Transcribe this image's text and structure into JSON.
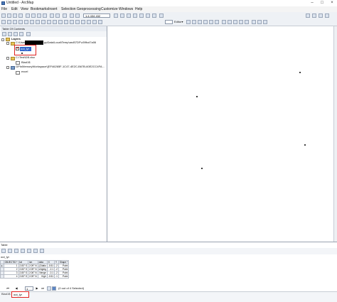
{
  "window": {
    "title": "Untitled - ArcMap",
    "controls": [
      "–",
      "□",
      "×"
    ]
  },
  "menu": [
    "File",
    "Edit",
    "View",
    "Bookmarks",
    "Insert",
    "Selection",
    "Geoprocessing",
    "Customize",
    "Windows",
    "Help"
  ],
  "toolbar": {
    "scale": "1:4 434 432",
    "editor_label": "Editor▾"
  },
  "toc": {
    "title": "Table Of Contents",
    "layers_label": "Layers",
    "folder1_prefix": "C:\\Users\\",
    "folder1_suffix": "ppData\\Local\\Temp\\arcB7DF\\c59fcd7a06",
    "layer1": "out_lyr",
    "folder2": "C:\\Test\\DB.xlsx",
    "table1": "Blad1$",
    "workspace": "GPInMemoryWorkspace\\{EF46265F-1C47-4E2C-B67B-60E2CC4FA...",
    "table2": "excel"
  },
  "table_panel": {
    "title": "Table",
    "name": "out_lyr",
    "columns": [
      "OBJECTID *",
      "lat",
      "lon",
      "data",
      "X",
      "Y",
      "Shape *"
    ],
    "rows": [
      [
        "1",
        "2.83° S",
        "2.09° N",
        "(Cidalu",
        "-0.51",
        "-2",
        "Point"
      ],
      [
        "2",
        "2.83° S",
        "2.09° N",
        "cNghtg",
        "-2.1",
        "-2",
        "Point"
      ],
      [
        "3",
        "2.80° S",
        "2.06° N",
        "Nenge",
        "-0.1",
        "-2",
        "Point"
      ],
      [
        "4",
        "2.83° S",
        "2.09° N",
        "Kigh",
        "-0.51",
        "-1",
        "Point"
      ]
    ],
    "page": "1",
    "selected_count": "(0 out of 4 Selected)",
    "tabs": [
      "Blad1$",
      "out_lyr"
    ]
  }
}
